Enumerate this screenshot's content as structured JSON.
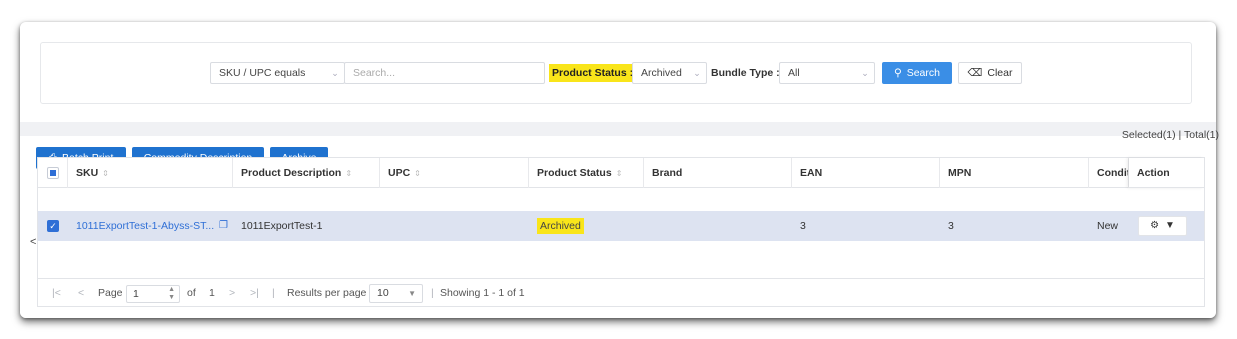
{
  "filters": {
    "sku_select": "SKU / UPC equals",
    "search_placeholder": "Search...",
    "status_label": "Product Status :",
    "status_value": "Archived",
    "bundle_label": "Bundle Type :",
    "bundle_value": "All",
    "search_button": "Search",
    "clear_button": "Clear"
  },
  "toolbar": {
    "batch_print": "Batch Print",
    "commodity_description": "Commodity Description",
    "archive": "Archive",
    "summary": "Selected(1) | Total(1)"
  },
  "table": {
    "columns": {
      "sku": "SKU",
      "product_description": "Product Description",
      "upc": "UPC",
      "product_status": "Product Status",
      "brand": "Brand",
      "ean": "EAN",
      "mpn": "MPN",
      "condition": "Condition",
      "action": "Action"
    },
    "rows": [
      {
        "sku": "1011ExportTest-1-Abyss-ST...",
        "product_description": "1011ExportTest-1",
        "upc": "",
        "product_status": "Archived",
        "brand": "",
        "ean": "3",
        "mpn": "3",
        "condition": "New"
      }
    ]
  },
  "pager": {
    "page_label": "Page",
    "page_value": "1",
    "of_label": "of",
    "total_pages": "1",
    "results_label": "Results per page",
    "per_page": "10",
    "showing": "Showing 1 - 1 of 1"
  },
  "colors": {
    "accent": "#3a8ee6",
    "highlight": "#f9e51a",
    "selected_row": "#dde3f1",
    "link": "#2f6fd6"
  }
}
